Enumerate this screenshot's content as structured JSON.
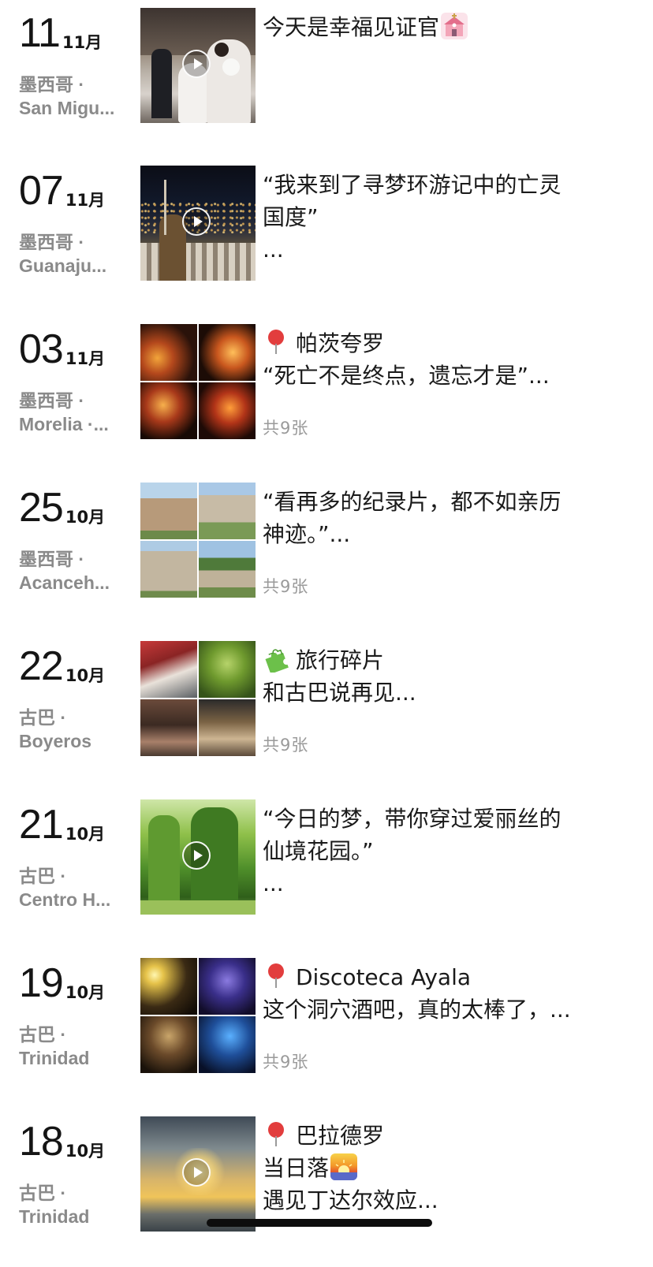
{
  "posts": [
    {
      "day": "11",
      "month": "11月",
      "country": "墨西哥 ·",
      "city": "San Migu...",
      "media": "video",
      "lines": [
        {
          "text": "今天是幸福见证官",
          "suffix_icon": "wedding-icon"
        }
      ],
      "count": ""
    },
    {
      "day": "07",
      "month": "11月",
      "country": "墨西哥 ·",
      "city": "Guanaju...",
      "media": "video",
      "lines": [
        {
          "text": "“我来到了寻梦环游记中的亡灵"
        },
        {
          "text": "国度”"
        },
        {
          "text": "..."
        }
      ],
      "count": ""
    },
    {
      "day": "03",
      "month": "11月",
      "country": "墨西哥 ·",
      "city": "Morelia ·...",
      "media": "grid",
      "lines": [
        {
          "text": "帕茨夸罗",
          "prefix_icon": "location-pin-icon"
        },
        {
          "text": "“死亡不是终点，遗忘才是”..."
        }
      ],
      "count": "共9张"
    },
    {
      "day": "25",
      "month": "10月",
      "country": "墨西哥 ·",
      "city": "Acanceh...",
      "media": "grid",
      "lines": [
        {
          "text": "“看再多的纪录片，都不如亲历"
        },
        {
          "text": "神迹。”..."
        }
      ],
      "count": "共9张"
    },
    {
      "day": "22",
      "month": "10月",
      "country": "古巴 ·",
      "city": "Boyeros",
      "media": "grid",
      "lines": [
        {
          "text": "旅行碎片",
          "prefix_icon": "puzzle-icon"
        },
        {
          "text": "和古巴说再见..."
        }
      ],
      "count": "共9张"
    },
    {
      "day": "21",
      "month": "10月",
      "country": "古巴 ·",
      "city": "Centro H...",
      "media": "video",
      "lines": [
        {
          "text": "“今日的梦，带你穿过爱丽丝的"
        },
        {
          "text": "仙境花园。”"
        },
        {
          "text": "..."
        }
      ],
      "count": ""
    },
    {
      "day": "19",
      "month": "10月",
      "country": "古巴 ·",
      "city": "Trinidad",
      "media": "grid",
      "lines": [
        {
          "text": "Discoteca Ayala",
          "prefix_icon": "location-pin-icon"
        },
        {
          "text": "这个洞穴酒吧，真的太棒了，..."
        }
      ],
      "count": "共9张"
    },
    {
      "day": "18",
      "month": "10月",
      "country": "古巴 ·",
      "city": "Trinidad",
      "media": "video",
      "lines": [
        {
          "text": "巴拉德罗",
          "prefix_icon": "location-pin-icon"
        },
        {
          "text": "当日落",
          "suffix_icon": "sunset-icon"
        },
        {
          "text": "遇见丁达尔效应..."
        }
      ],
      "count": ""
    }
  ]
}
